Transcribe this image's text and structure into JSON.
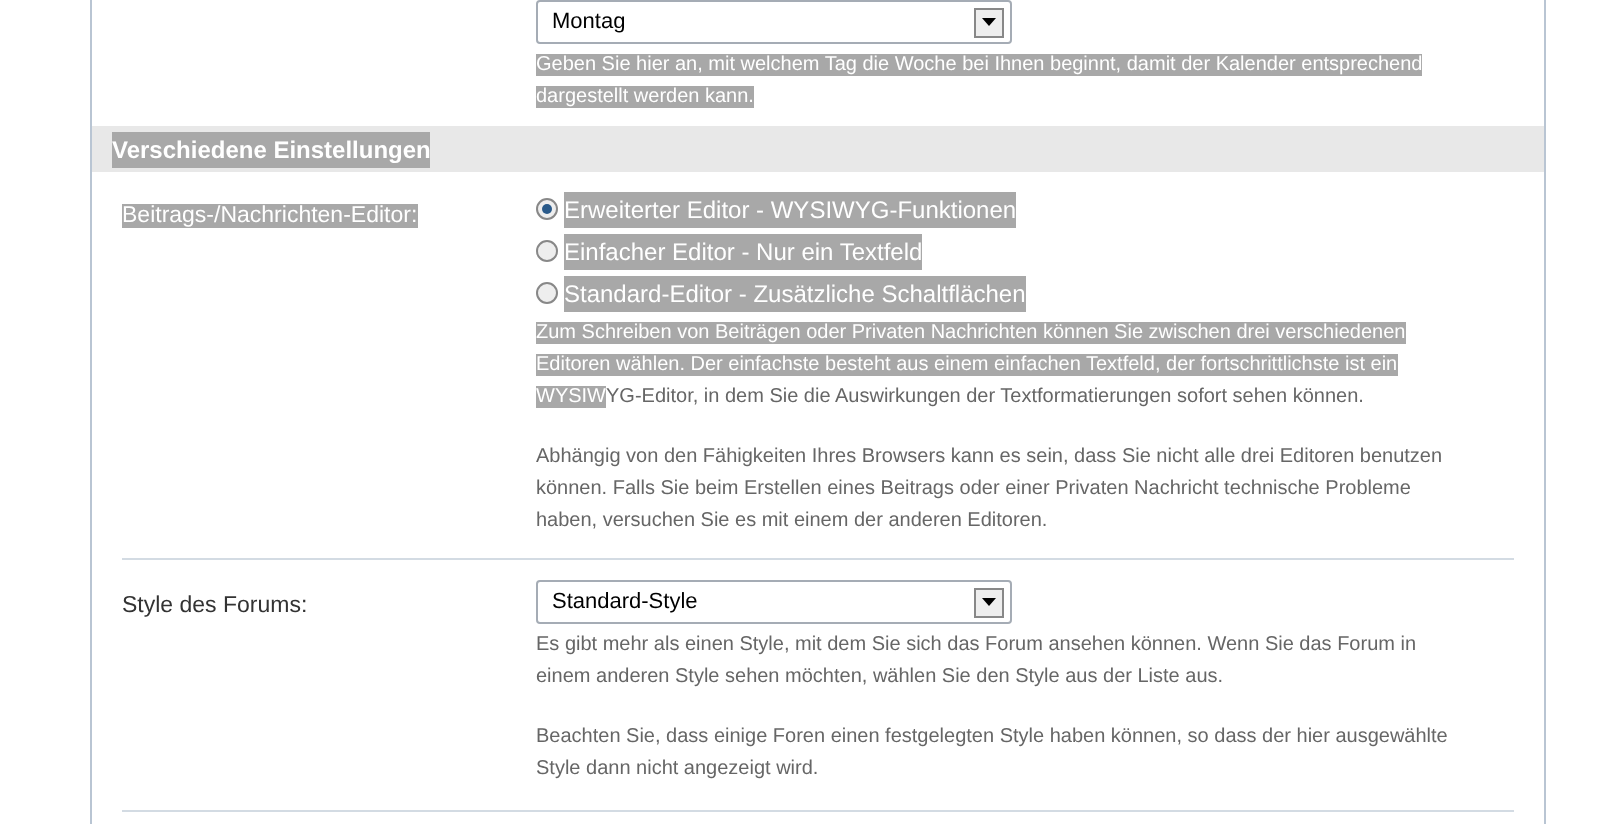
{
  "week_start": {
    "select": "Montag",
    "help": {
      "highlighted": "Geben Sie hier an, mit welchem Tag die Woche bei Ihnen beginnt, damit der Kalender entsprechend dargestellt werden kann."
    }
  },
  "section": {
    "title": "Verschiedene Einstellungen",
    "highlighted": true
  },
  "editor": {
    "label": "Beitrags-/Nachrichten-Editor:",
    "label_highlighted": true,
    "options": [
      {
        "label": "Erweiterter Editor - WYSIWYG-Funktionen",
        "selected": true
      },
      {
        "label": "Einfacher Editor - Nur ein Textfeld",
        "selected": false
      },
      {
        "label": "Standard-Editor - Zusätzliche Schaltflächen",
        "selected": false
      }
    ],
    "help": [
      {
        "highlighted": "Zum Schreiben von Beiträgen oder Privaten Nachrichten können Sie zwischen drei verschiedenen Editoren wählen. Der einfachste besteht aus einem einfachen Textfeld, der fortschrittlichste ist ein WYSIW",
        "rest": "YG-Editor, in dem Sie die Auswirkungen der Textformatierungen sofort sehen können."
      },
      {
        "rest": "Abhängig von den Fähigkeiten Ihres Browsers kann es sein, dass Sie nicht alle drei Editoren benutzen können. Falls Sie beim Erstellen eines Beitrags oder einer Privaten Nachricht technische Probleme haben, versuchen Sie es mit einem der anderen Editoren."
      }
    ]
  },
  "style": {
    "label": "Style des Forums:",
    "select": "Standard-Style",
    "help": [
      {
        "rest": "Es gibt mehr als einen Style, mit dem Sie sich das Forum ansehen können. Wenn Sie das Forum in einem anderen Style sehen möchten, wählen Sie den Style aus der Liste aus."
      },
      {
        "rest": "Beachten Sie, dass einige Foren einen festgelegten Style haben können, so dass der hier ausgewählte Style dann nicht angezeigt wird."
      }
    ]
  }
}
